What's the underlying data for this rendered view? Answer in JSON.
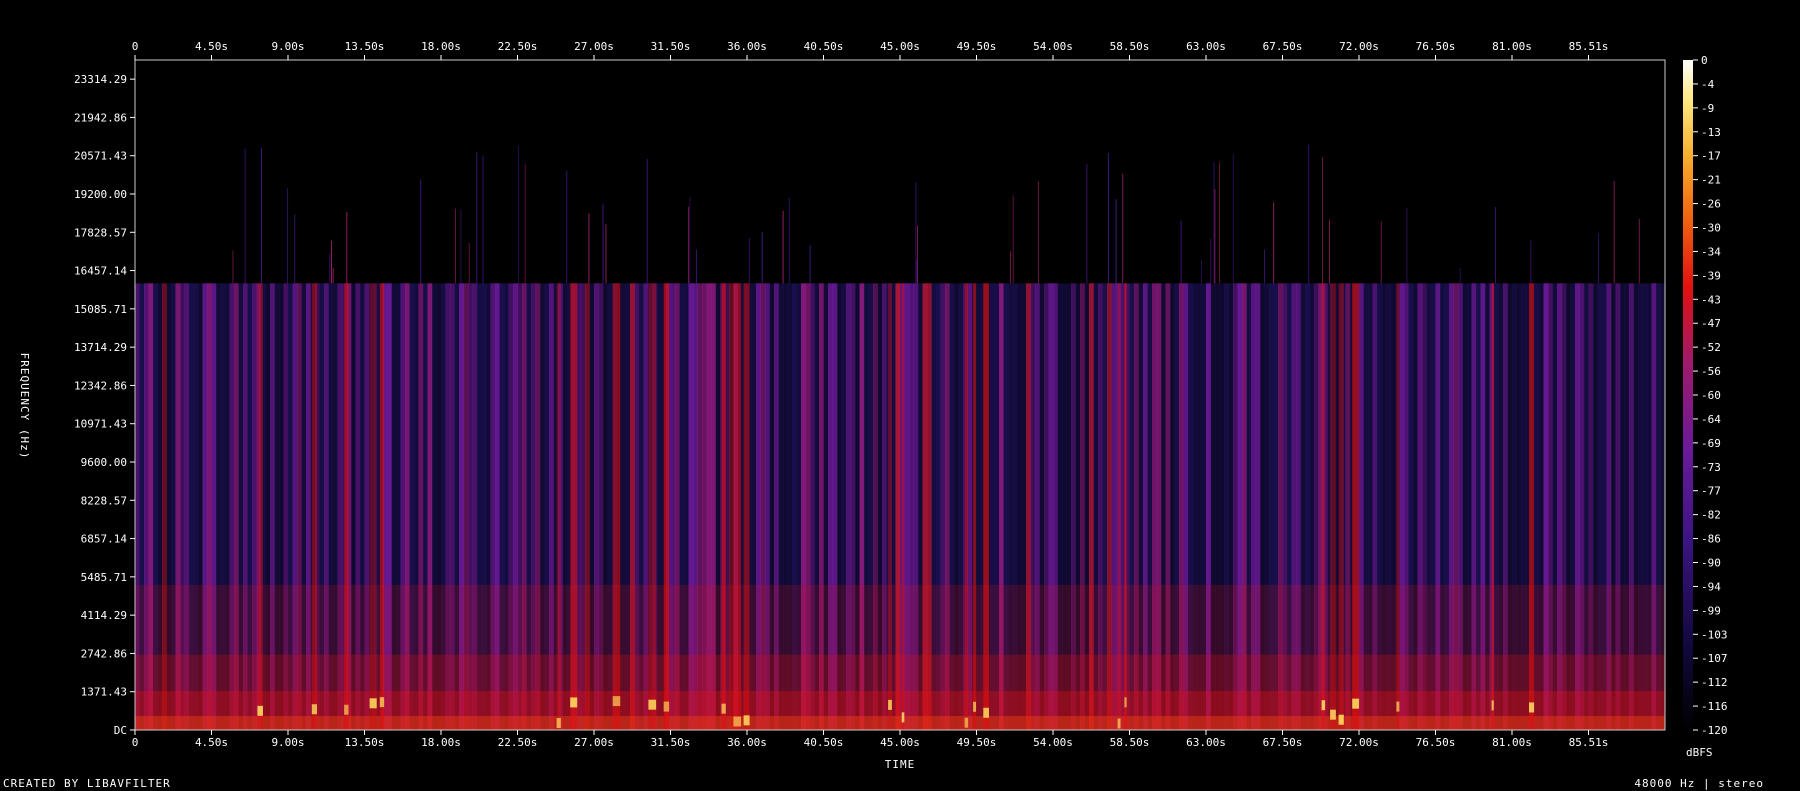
{
  "chart_data": {
    "type": "heatmap",
    "xlabel": "TIME",
    "ylabel": "FREQUENCY (Hz)",
    "x_ticks": [
      "0",
      "4.50s",
      "9.00s",
      "13.50s",
      "18.00s",
      "22.50s",
      "27.00s",
      "31.50s",
      "36.00s",
      "40.50s",
      "45.00s",
      "49.50s",
      "54.00s",
      "58.50s",
      "63.00s",
      "67.50s",
      "72.00s",
      "76.50s",
      "81.00s",
      "85.51s"
    ],
    "y_ticks": [
      "DC",
      "1371.43",
      "2742.86",
      "4114.29",
      "5485.71",
      "6857.14",
      "8228.57",
      "9600.00",
      "10971.43",
      "12342.86",
      "13714.29",
      "15085.71",
      "16457.14",
      "17828.57",
      "19200.00",
      "20571.43",
      "21942.86",
      "23314.29"
    ],
    "y_max_hz": 24000,
    "x_max_s": 90,
    "colorbar_label": "dBFS",
    "colorbar_ticks": [
      "0",
      "-4",
      "-9",
      "-13",
      "-17",
      "-21",
      "-26",
      "-30",
      "-34",
      "-39",
      "-43",
      "-47",
      "-52",
      "-56",
      "-60",
      "-64",
      "-69",
      "-73",
      "-77",
      "-82",
      "-86",
      "-90",
      "-94",
      "-99",
      "-103",
      "-107",
      "-112",
      "-116",
      "-120"
    ],
    "colorbar_range_db": [
      -120,
      0
    ],
    "content_cutoff_hz": 16000,
    "colors": {
      "background": "#000000",
      "low": "#1a1050",
      "mid": "#6a1a9a",
      "high": "#e01010",
      "peak": "#ffe060",
      "max": "#ffffff"
    }
  },
  "footer": {
    "created_by": "CREATED BY LIBAVFILTER",
    "format": "48000 Hz | stereo"
  }
}
